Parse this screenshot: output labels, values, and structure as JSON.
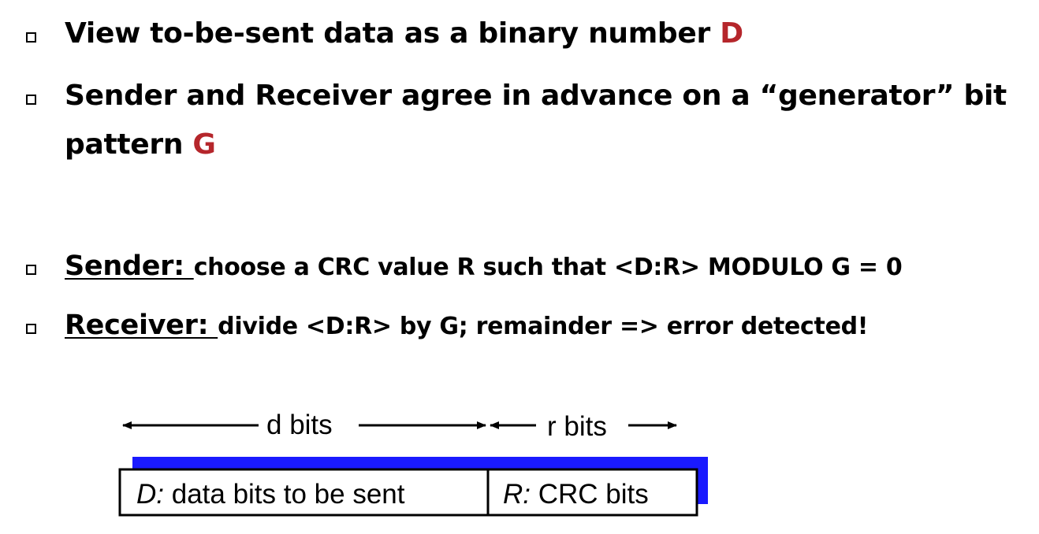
{
  "bullets": [
    {
      "text": "View to-be-sent data as a binary number ",
      "highlight": "D"
    },
    {
      "text": "Sender and Receiver agree in advance on a “generator” bit",
      "text2": "pattern ",
      "highlight": "G"
    },
    {
      "lead": "Sender: ",
      "rest": "choose a CRC value R such that <D:R> MODULO G = 0"
    },
    {
      "lead": "Receiver: ",
      "rest": "divide <D:R> by G; remainder => error detected!"
    }
  ],
  "diagram": {
    "d_label": "d bits",
    "r_label": "r bits",
    "box_d_prefix": "D:",
    "box_d_text": " data bits to be sent",
    "box_r_prefix": "R:",
    "box_r_text": " CRC bits"
  },
  "colors": {
    "highlight": "#b5262b",
    "shadow": "#1a1aff"
  }
}
